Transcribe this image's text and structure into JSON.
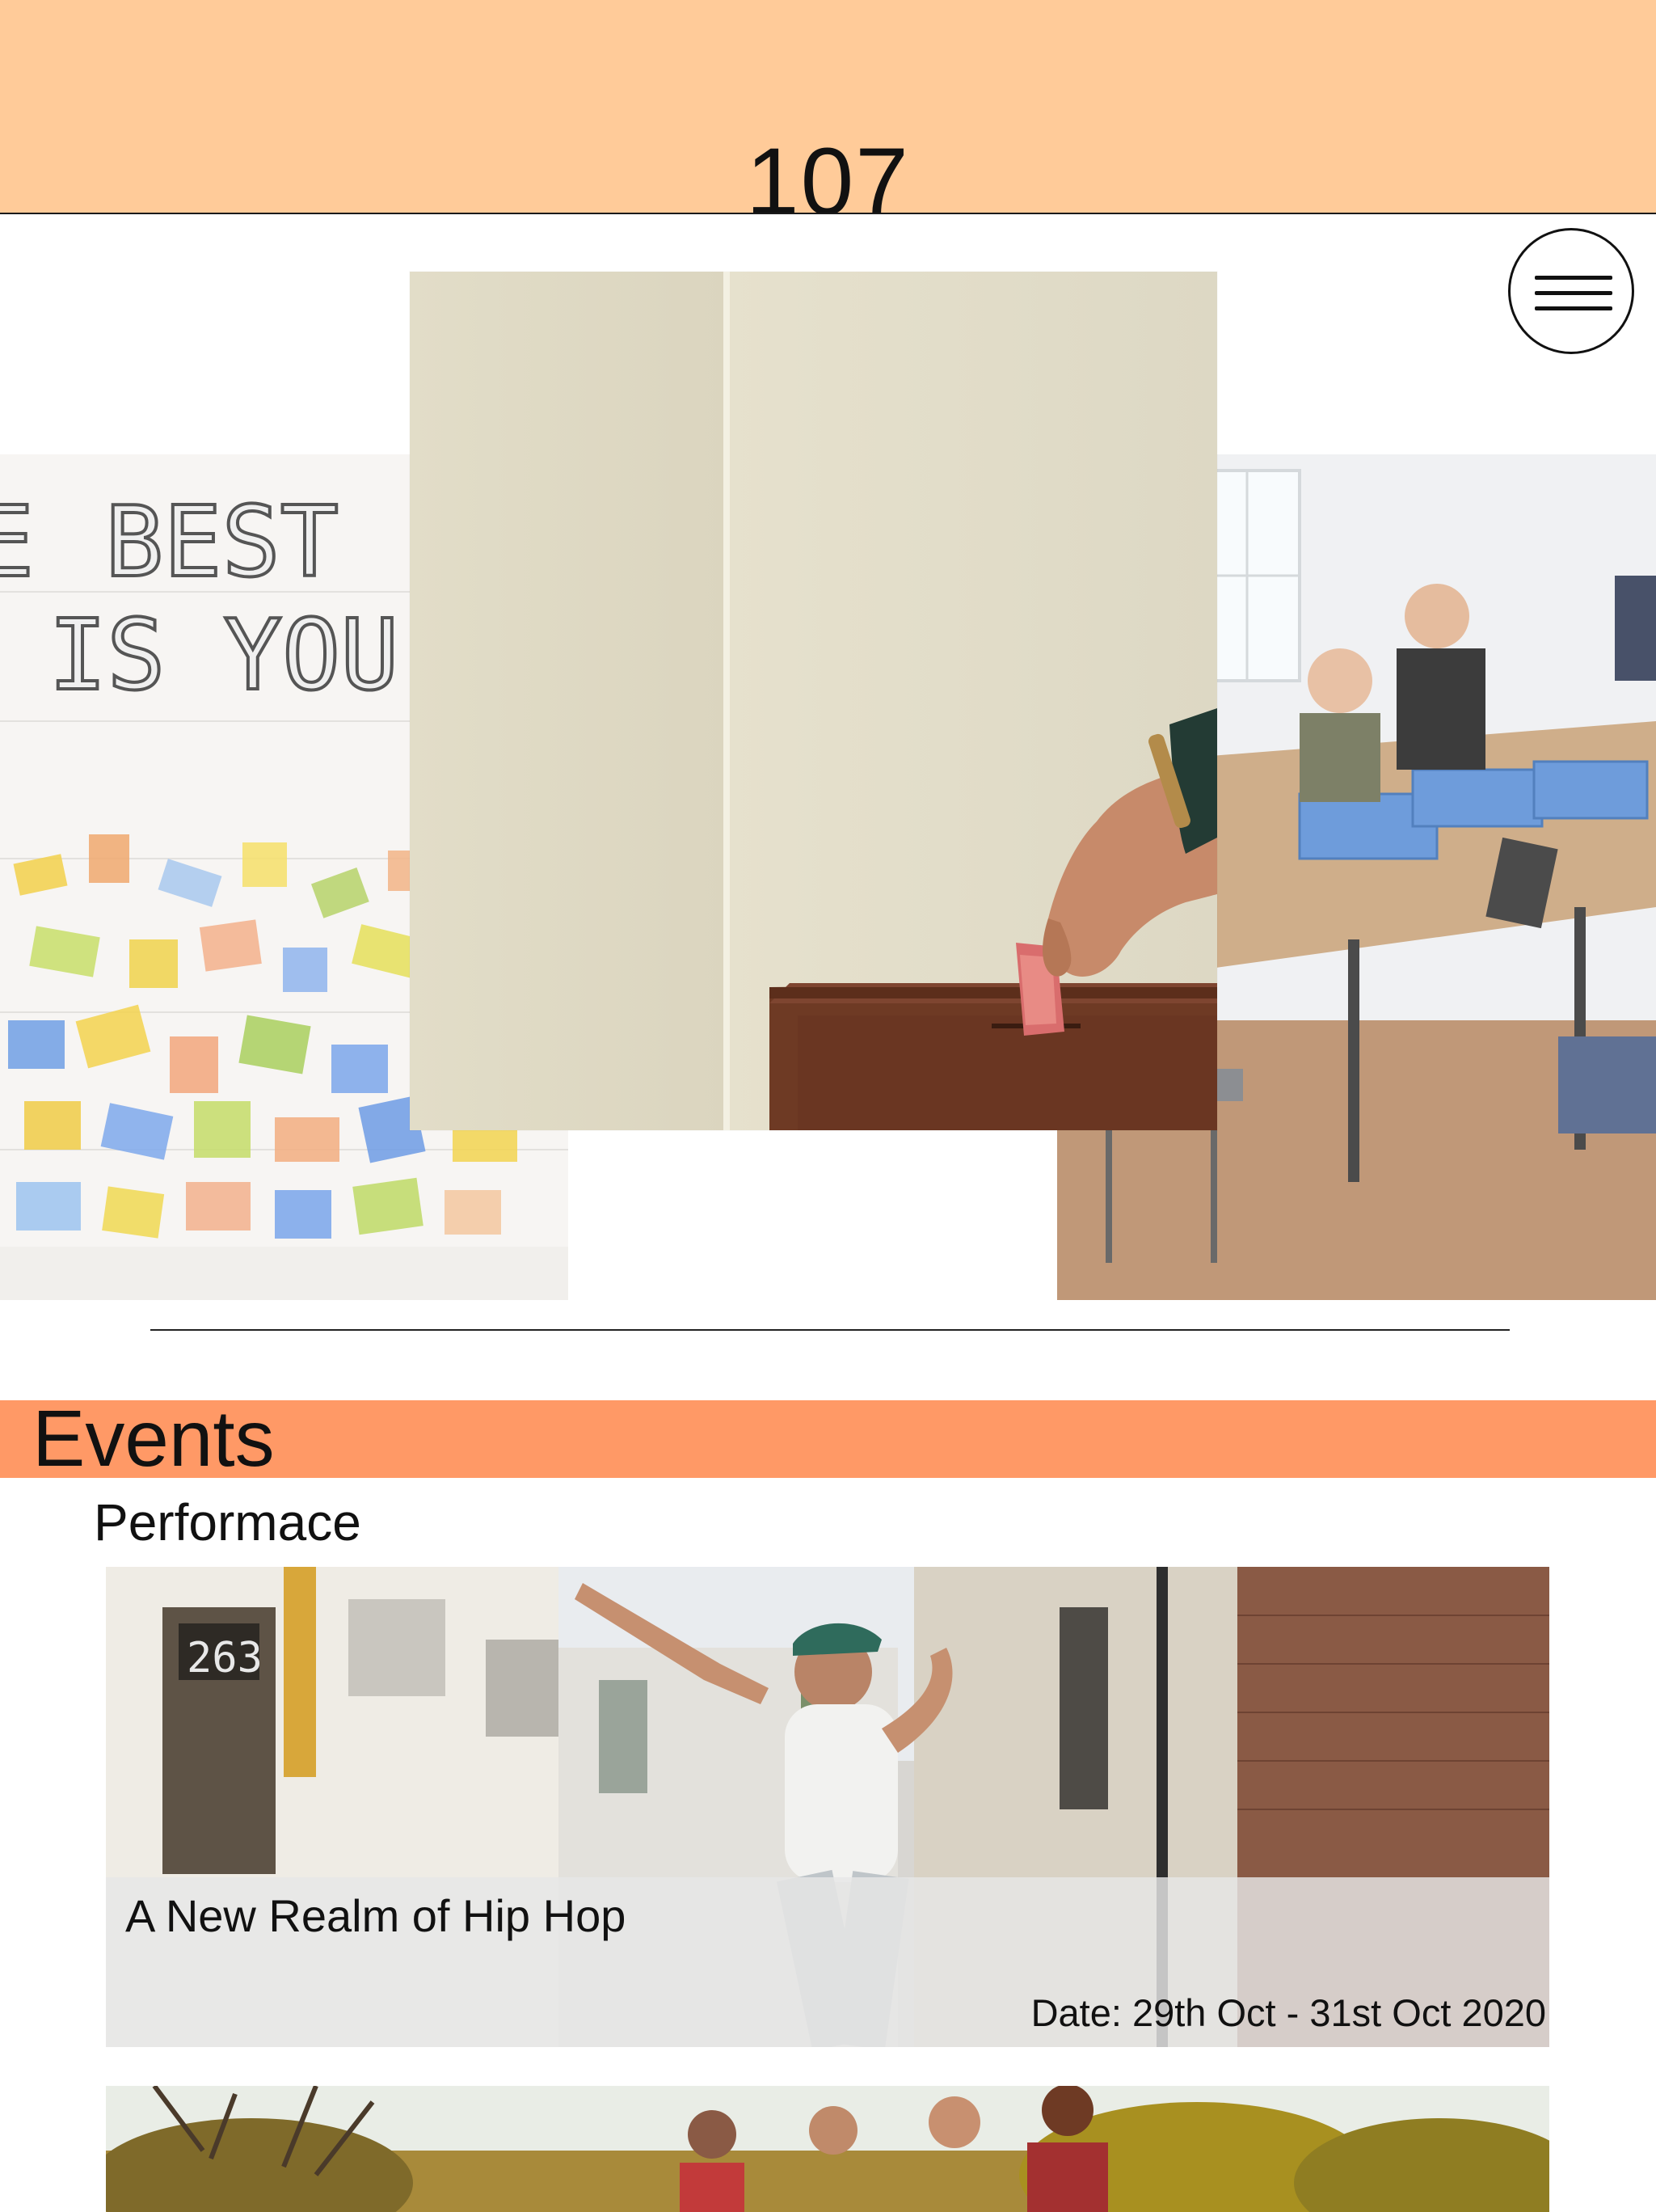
{
  "header": {
    "logo_text": "107",
    "background_color": "#ffcb99"
  },
  "menu": {
    "icon": "hamburger-icon"
  },
  "hero": {
    "left_photo": {
      "mural_text_line1": "BEST",
      "mural_text_line2": "IS YOU!"
    },
    "center_photo": {
      "subject": "donation-box-photo"
    },
    "right_photo": {
      "subject": "kids-robotics-class-photo"
    }
  },
  "events": {
    "section_title": "Events",
    "band_color": "#ff9966",
    "category": "Performace",
    "items": [
      {
        "title": "A New Realm of Hip Hop",
        "date": "Date: 29th Oct - 31st Oct 2020"
      }
    ]
  }
}
